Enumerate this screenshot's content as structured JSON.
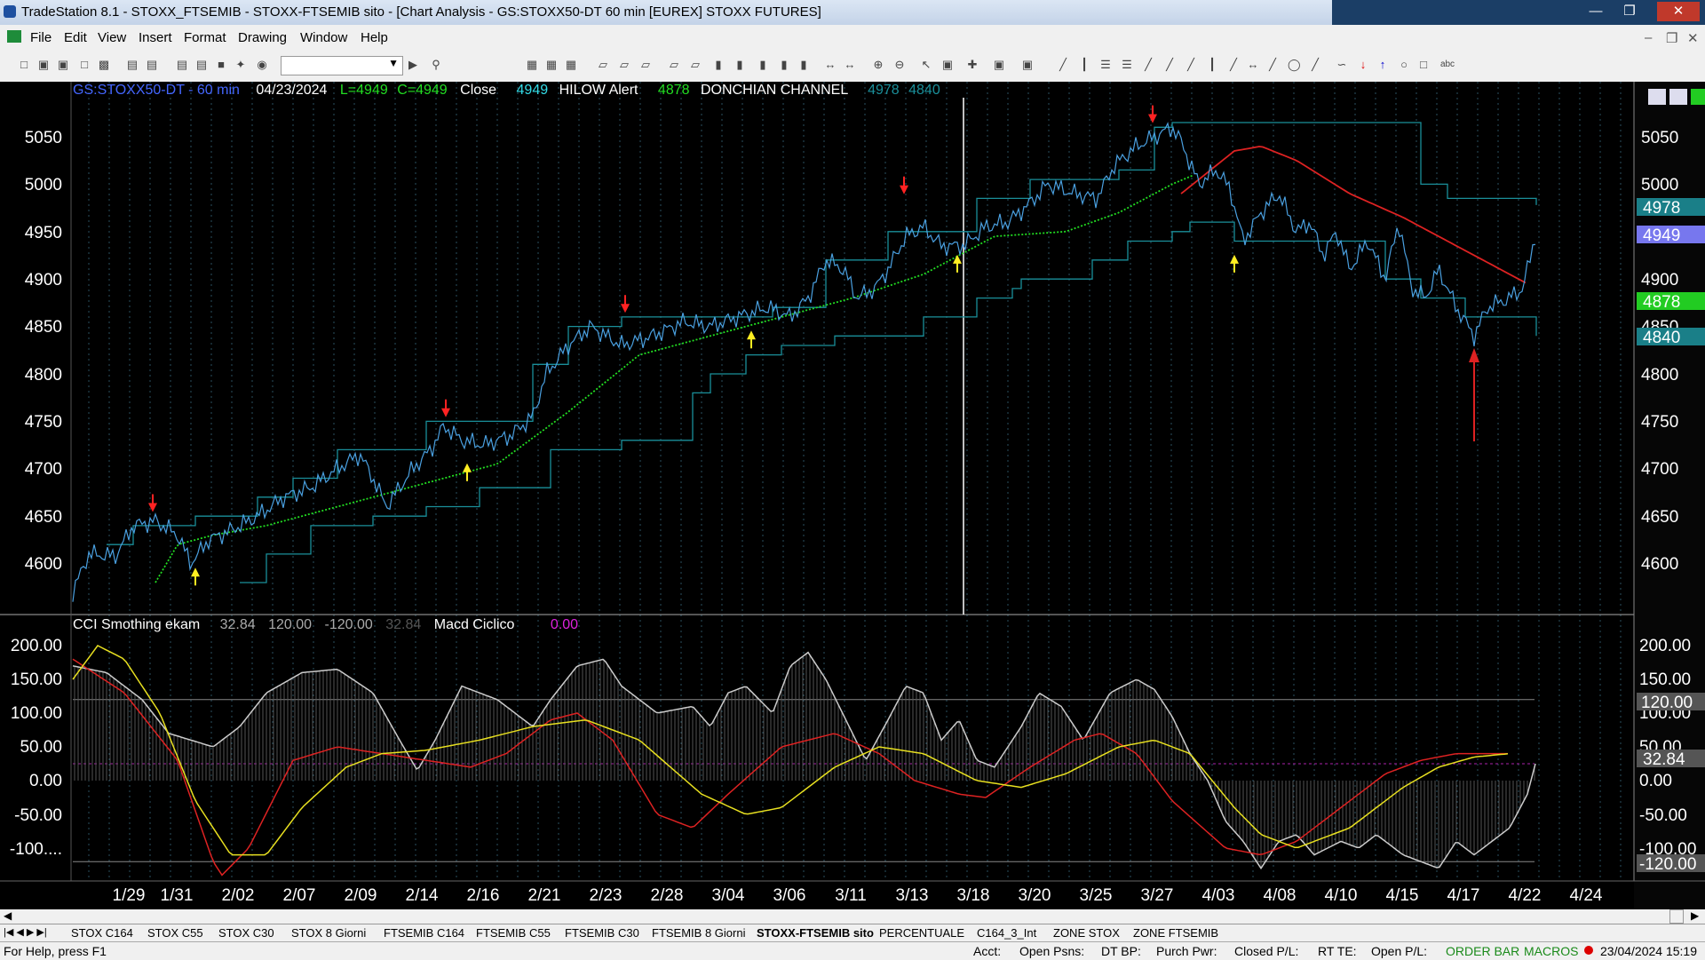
{
  "window": {
    "title": "TradeStation 8.1 - STOXX_FTSEMIB - STOXX-FTSEMIB sito - [Chart Analysis - GS:STOXX50-DT  60 min  [EUREX] STOXX FUTURES]"
  },
  "menu": [
    "File",
    "Edit",
    "View",
    "Insert",
    "Format",
    "Drawing",
    "Window",
    "Help"
  ],
  "chart": {
    "header": {
      "symbol": "GS:STOXX50-DT - 60 min",
      "date": "04/23/2024",
      "low": "L=4949",
      "close_eq": "C=4949",
      "close_label": "Close",
      "close_value": "4949",
      "hilow_label": "HILOW Alert",
      "hilow_value": "4878",
      "donchian_label": "DONCHIAN CHANNEL",
      "donchian_upper": "4978",
      "donchian_lower": "4840"
    },
    "price_axis": [
      "5050",
      "5000",
      "4950",
      "4900",
      "4850",
      "4800",
      "4750",
      "4700",
      "4650",
      "4600"
    ],
    "price_badges": {
      "upper": "4978",
      "close": "4949",
      "hilow": "4878",
      "lower": "4840"
    },
    "colors": {
      "price": "#33dde8",
      "donchian": "#1a8f9a",
      "hilow": "#22dd22",
      "red_ma": "#dd2222",
      "badge_close": "#7777ee",
      "badge_hilow": "#22cc22",
      "badge_channel": "#1a7f88"
    },
    "arrows_down": [
      {
        "x": "1/29"
      },
      {
        "x": "2/14"
      },
      {
        "x": "2/22"
      },
      {
        "x": "3/13"
      },
      {
        "x": "3/26"
      }
    ],
    "arrows_up": [
      {
        "x": "1/31"
      },
      {
        "x": "2/15"
      },
      {
        "x": "3/04"
      },
      {
        "x": "3/15"
      },
      {
        "x": "4/03"
      }
    ],
    "indicator": {
      "label": "CCI Smothing ekam",
      "v1": "32.84",
      "v2": "120.00",
      "v3": "-120.00",
      "v4": "32.84",
      "macd_label": "Macd Ciclico",
      "macd_value": "0.00",
      "axis": [
        "200.00",
        "150.00",
        "100.00",
        "50.00",
        "0.00",
        "-50.00",
        "-100...."
      ],
      "axis_right": [
        "200.00",
        "150.00",
        "100.00",
        "50.00",
        "0.00",
        "-50.00",
        "-100.00"
      ],
      "badges": {
        "upper": "120.00",
        "value": "32.84",
        "lower": "-120.00"
      }
    },
    "date_axis": [
      "1/29",
      "1/31",
      "2/02",
      "2/07",
      "2/09",
      "2/14",
      "2/16",
      "2/21",
      "2/23",
      "2/28",
      "3/04",
      "3/06",
      "3/11",
      "3/13",
      "3/18",
      "3/20",
      "3/25",
      "3/27",
      "4/03",
      "4/08",
      "4/10",
      "4/15",
      "4/17",
      "4/22",
      "4/24"
    ]
  },
  "tabs": [
    "STOX C164",
    "STOX C55",
    "STOX  C30",
    "STOX  8 Giorni",
    "FTSEMIB C164",
    "FTSEMIB C55",
    "FTSEMIB C30",
    "FTSEMIB  8 Giorni",
    "STOXX-FTSEMIB sito",
    "PERCENTUALE",
    "C164_3_Int",
    "ZONE STOX",
    "ZONE FTSEMIB"
  ],
  "active_tab": "STOXX-FTSEMIB sito",
  "status": {
    "help": "For Help, press F1",
    "acct": "Acct:",
    "open_psns": "Open Psns:",
    "dt_bp": "DT BP:",
    "purch_pwr": "Purch Pwr:",
    "closed_pl": "Closed P/L:",
    "rt_te": "RT TE:",
    "open_pl": "Open P/L:",
    "order_bar": "ORDER BAR",
    "macros": "MACROS",
    "datetime": "23/04/2024 15:19"
  }
}
